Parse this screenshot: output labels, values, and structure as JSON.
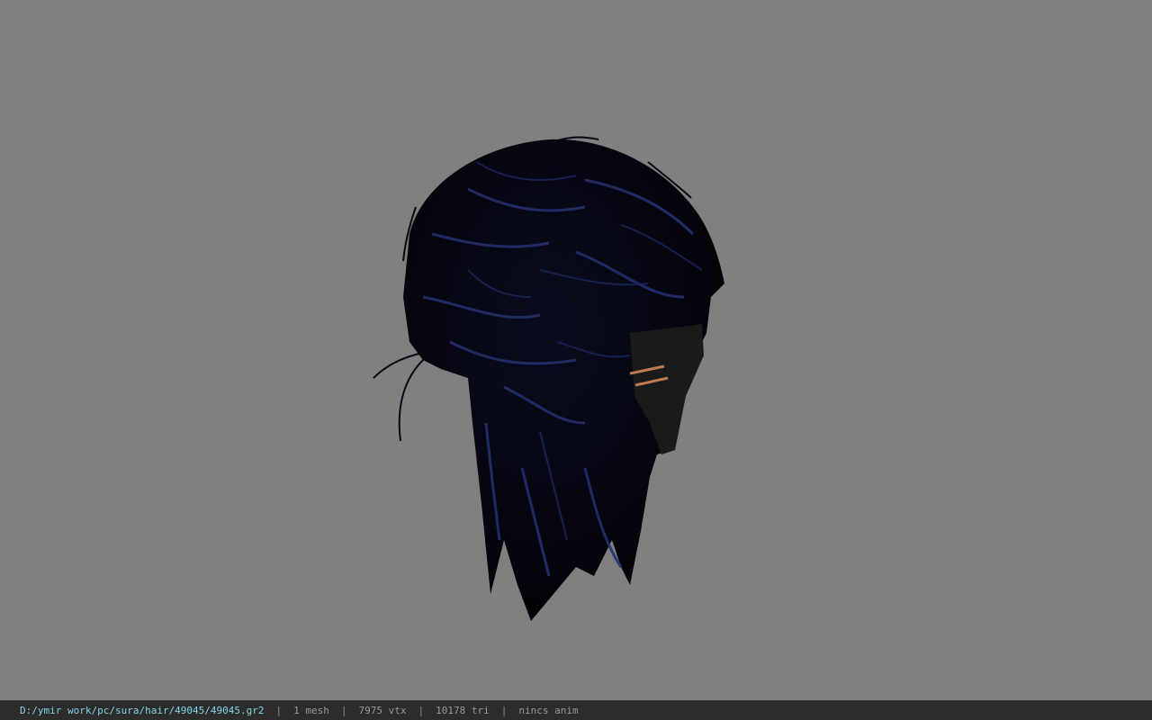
{
  "viewport": {
    "background_color": "#808080",
    "model": {
      "hair_color": "#050611",
      "highlight_color": "#2a3a80",
      "clip_color": "#c07a50"
    }
  },
  "status_bar": {
    "file_path": "D:/ymir work/pc/sura/hair/49045/49045.gr2",
    "separator": "|",
    "mesh_count": "1 mesh",
    "vertex_count": "7975 vtx",
    "triangle_count": "10178 tri",
    "animation": "nincs anim"
  }
}
